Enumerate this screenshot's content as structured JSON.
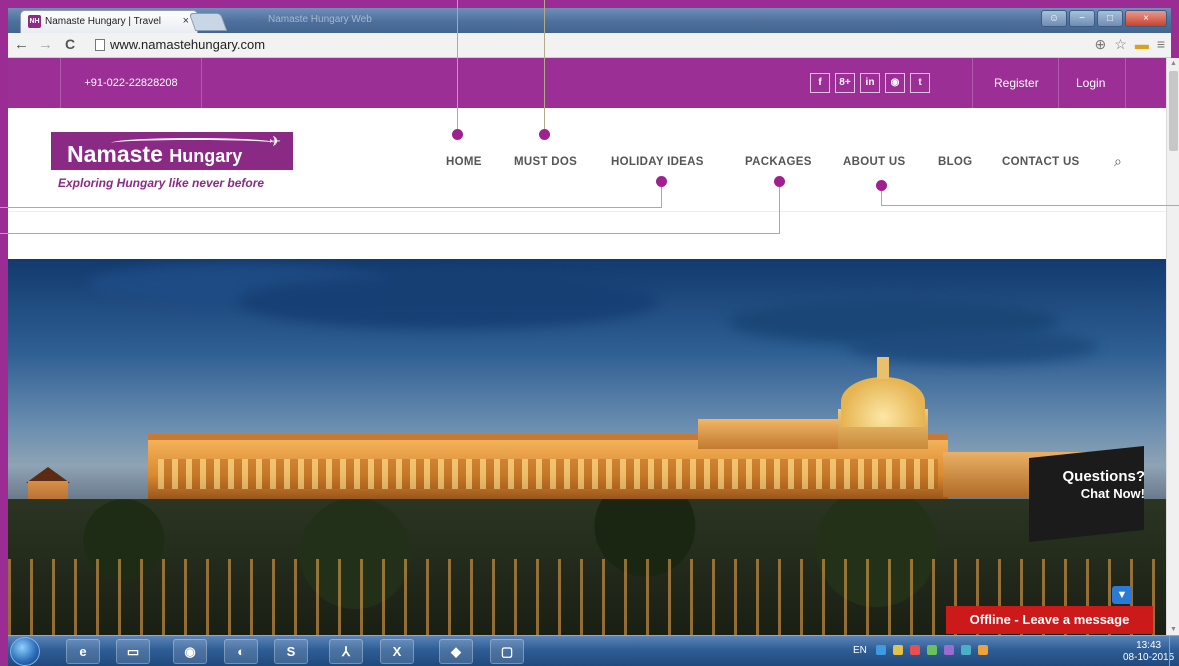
{
  "browser": {
    "tab_title": "Namaste Hungary | Travel",
    "tab_close": "×",
    "second_tab_title": "Namaste Hungary Web",
    "url": "www.namastehungary.com",
    "back": "←",
    "forward": "→",
    "reload": "C",
    "zoom_icon": "⊕",
    "star_icon": "☆",
    "menu_icon": "≡",
    "window_minimize": "−",
    "window_maximize": "□",
    "window_close": "×"
  },
  "topbar": {
    "phone": "+91-022-22828208",
    "socials": [
      "f",
      "8+",
      "in",
      "◉",
      "t"
    ],
    "register": "Register",
    "login": "Login"
  },
  "header": {
    "logo_main": "Namaste",
    "logo_sub": "Hungary",
    "tagline": "Exploring Hungary like never before",
    "menu": [
      "HOME",
      "MUST DOS",
      "HOLIDAY IDEAS",
      "PACKAGES",
      "ABOUT US",
      "BLOG",
      "CONTACT US"
    ]
  },
  "chat": {
    "line1": "Questions?",
    "line2": "Chat Now!",
    "offline": "Offline - Leave a message"
  },
  "taskbar": {
    "lang": "EN",
    "time": "13:43",
    "date": "08-10-2015",
    "apps": [
      "ie-icon",
      "folder-icon",
      "chrome-icon",
      "firefox-icon",
      "skype-icon",
      "acrobat-icon",
      "excel-icon",
      "app-icon",
      "window-icon"
    ]
  },
  "colors": {
    "brand_purple": "#9c2f96",
    "annotation_dot": "#a0208f",
    "offline_red": "#cc1a1a"
  }
}
